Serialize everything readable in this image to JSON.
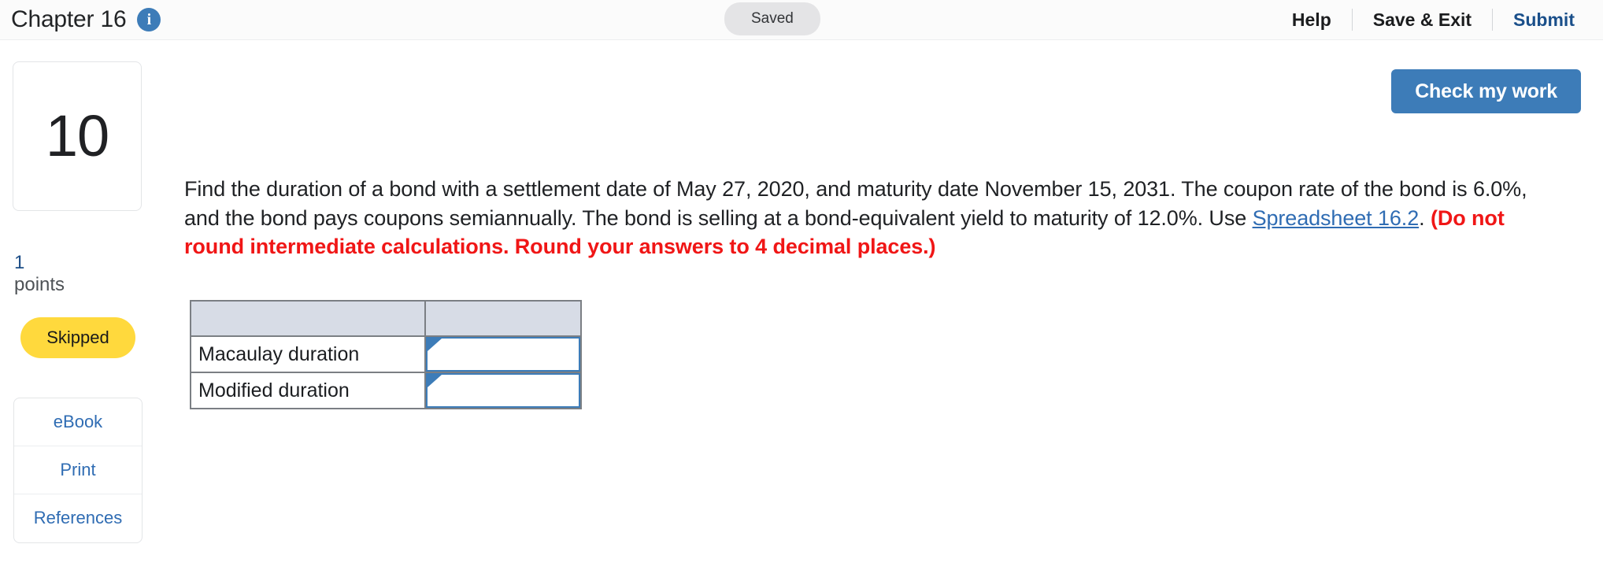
{
  "header": {
    "chapter_title": "Chapter 16",
    "info_icon": "info-icon",
    "saved_label": "Saved",
    "actions": [
      {
        "label": "Help",
        "style": "dark"
      },
      {
        "label": "Save & Exit",
        "style": "dark"
      },
      {
        "label": "Submit",
        "style": "link"
      }
    ]
  },
  "rail": {
    "question_number": "10",
    "points_value": "1",
    "points_label": "points",
    "status_badge": "Skipped",
    "resources": [
      {
        "label": "eBook"
      },
      {
        "label": "Print"
      },
      {
        "label": "References"
      }
    ]
  },
  "main": {
    "check_button": "Check my work",
    "question": {
      "part1": "Find the duration of a bond with a settlement date of May 27, 2020, and maturity date November 15, 2031. The coupon rate of the bond is 6.0%, and the bond pays coupons semiannually. The bond is selling at a bond-equivalent yield to maturity of 12.0%. Use ",
      "link": "Spreadsheet 16.2",
      "part2": ". ",
      "instruction": "(Do not round intermediate calculations. Round your answers to 4 decimal places.)"
    },
    "answer_table": {
      "headers": [
        "",
        ""
      ],
      "rows": [
        {
          "label": "Macaulay duration",
          "value": "",
          "placeholder": ""
        },
        {
          "label": "Modified duration",
          "value": "",
          "placeholder": ""
        }
      ]
    }
  },
  "colors": {
    "accent_blue": "#3d7cb8",
    "link_blue": "#2f6cb3",
    "submit_blue": "#1a4f8a",
    "warning_red": "#f01616",
    "skipped_yellow": "#ffd93d",
    "table_header_gray": "#d7dce6"
  }
}
